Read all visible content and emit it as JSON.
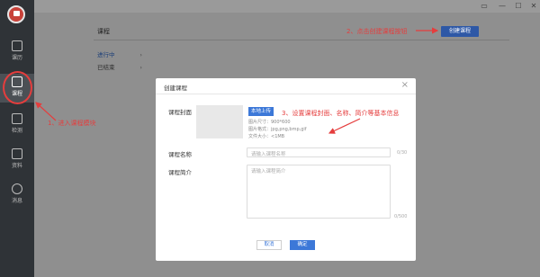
{
  "sidebar": {
    "items": [
      {
        "label": "课历",
        "icon": "calendar-icon"
      },
      {
        "label": "课程",
        "icon": "book-icon"
      },
      {
        "label": "检测",
        "icon": "grid-icon"
      },
      {
        "label": "资料",
        "icon": "layers-icon"
      },
      {
        "label": "消息",
        "icon": "message-icon"
      }
    ],
    "active": "课程"
  },
  "window": {
    "buttons": [
      "screen-icon",
      "minimize-icon",
      "maximize-icon",
      "close-icon"
    ]
  },
  "page": {
    "title": "课程",
    "tabs": [
      {
        "label": "进行中",
        "active": true
      },
      {
        "label": "已结束",
        "active": false
      }
    ],
    "create_button": "创建课程"
  },
  "modal": {
    "title": "创建课程",
    "cover_label": "课程封面",
    "upload_button": "本地上传",
    "hints": [
      "图片尺寸：900*600",
      "图片格式：jpg,png,bmp,gif",
      "文件大小：<1MB"
    ],
    "name_label": "课程名称",
    "name_placeholder": "请输入课程名称",
    "name_counter": "0/30",
    "intro_label": "课程简介",
    "intro_placeholder": "请输入课程简介",
    "intro_counter": "0/500",
    "cancel": "取消",
    "confirm": "确定"
  },
  "annotations": {
    "step1": "1、进入课程模块",
    "step2": "2、点击创建课程按钮",
    "step3": "3、设置课程封面、名称、简介等基本信息"
  },
  "colors": {
    "sidebar_bg": "#2f3337",
    "primary": "#3c78d8",
    "annotation": "#e53d3d"
  }
}
